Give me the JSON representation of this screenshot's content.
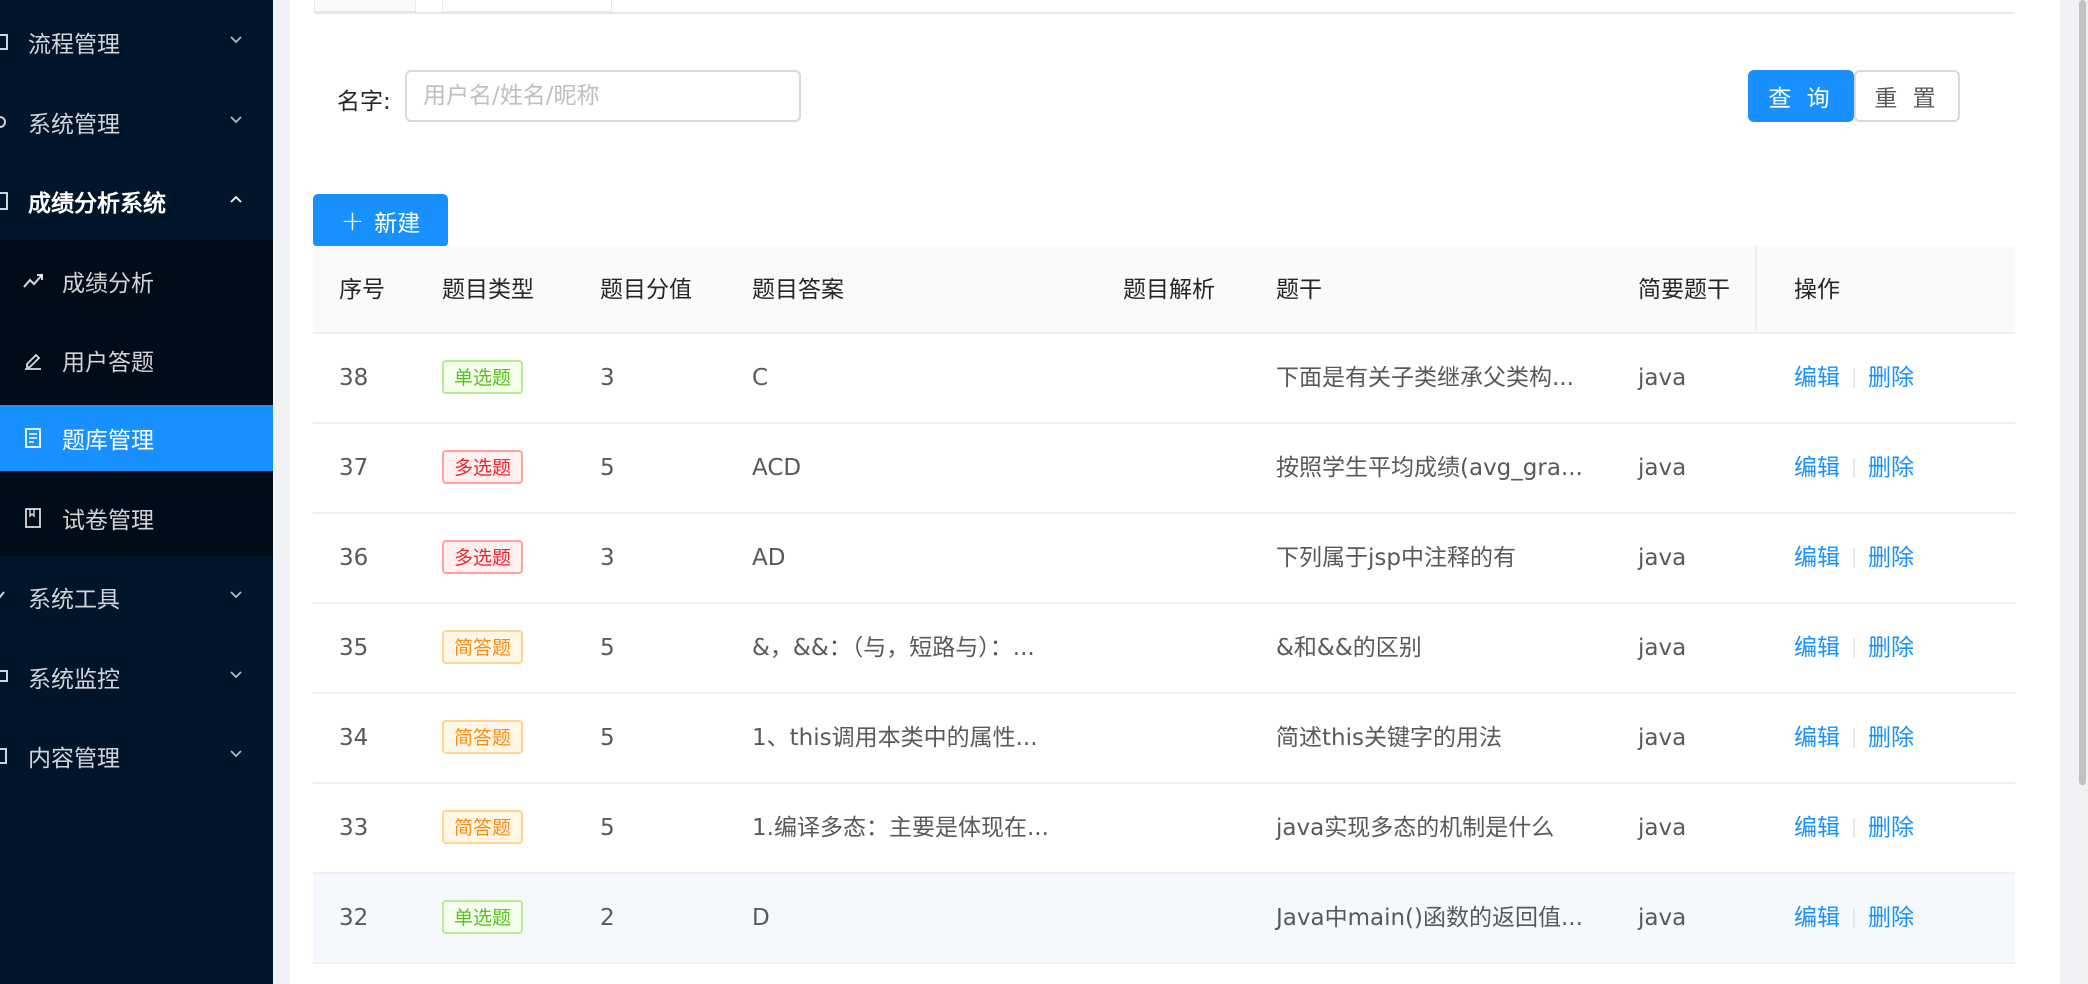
{
  "sidebar": {
    "menus": [
      {
        "label": "流程管理",
        "icon": "flow-icon"
      },
      {
        "label": "系统管理",
        "icon": "settings-icon"
      },
      {
        "label": "成绩分析系统",
        "icon": "score-system-icon"
      },
      {
        "label": "系统工具",
        "icon": "tool-icon"
      },
      {
        "label": "系统监控",
        "icon": "monitor-icon"
      },
      {
        "label": "内容管理",
        "icon": "content-icon"
      }
    ],
    "submenu": [
      {
        "label": "成绩分析",
        "icon": "line-chart-icon"
      },
      {
        "label": "用户答题",
        "icon": "edit-icon"
      },
      {
        "label": "题库管理",
        "icon": "file-list-icon"
      },
      {
        "label": "试卷管理",
        "icon": "book-icon"
      }
    ]
  },
  "search": {
    "label": "名字:",
    "placeholder": "用户名/姓名/昵称",
    "value": "",
    "query_label": "查 询",
    "reset_label": "重 置"
  },
  "toolbar": {
    "new_label": "新建"
  },
  "table": {
    "columns": [
      "序号",
      "题目类型",
      "题目分值",
      "题目答案",
      "题目解析",
      "题干",
      "简要题干",
      "操作"
    ],
    "edit_label": "编辑",
    "delete_label": "删除",
    "rows": [
      {
        "id": "38",
        "type": "单选题",
        "score": "3",
        "answer": "C",
        "analysis": "",
        "stem": "下面是有关子类继承父类构...",
        "brief": "java"
      },
      {
        "id": "37",
        "type": "多选题",
        "score": "5",
        "answer": "ACD",
        "analysis": "",
        "stem": "按照学生平均成绩(avg_gra...",
        "brief": "java"
      },
      {
        "id": "36",
        "type": "多选题",
        "score": "3",
        "answer": "AD",
        "analysis": "",
        "stem": "下列属于jsp中注释的有",
        "brief": "java"
      },
      {
        "id": "35",
        "type": "简答题",
        "score": "5",
        "answer": "&，&&：（与，短路与）：...",
        "analysis": "",
        "stem": "&和&&的区别",
        "brief": "java"
      },
      {
        "id": "34",
        "type": "简答题",
        "score": "5",
        "answer": "1、this调用本类中的属性...",
        "analysis": "",
        "stem": "简述this关键字的用法",
        "brief": "java"
      },
      {
        "id": "33",
        "type": "简答题",
        "score": "5",
        "answer": "1.编译多态：主要是体现在...",
        "analysis": "",
        "stem": "java实现多态的机制是什么",
        "brief": "java"
      },
      {
        "id": "32",
        "type": "单选题",
        "score": "2",
        "answer": "D",
        "analysis": "",
        "stem": "Java中main()函数的返回值...",
        "brief": "java"
      }
    ]
  },
  "colors": {
    "sidebar_bg": "#001529",
    "submenu_bg": "#000c17",
    "primary": "#1890ff",
    "tag_single": "#52c41a",
    "tag_multi": "#f5222d",
    "tag_short": "#fa8c16"
  }
}
